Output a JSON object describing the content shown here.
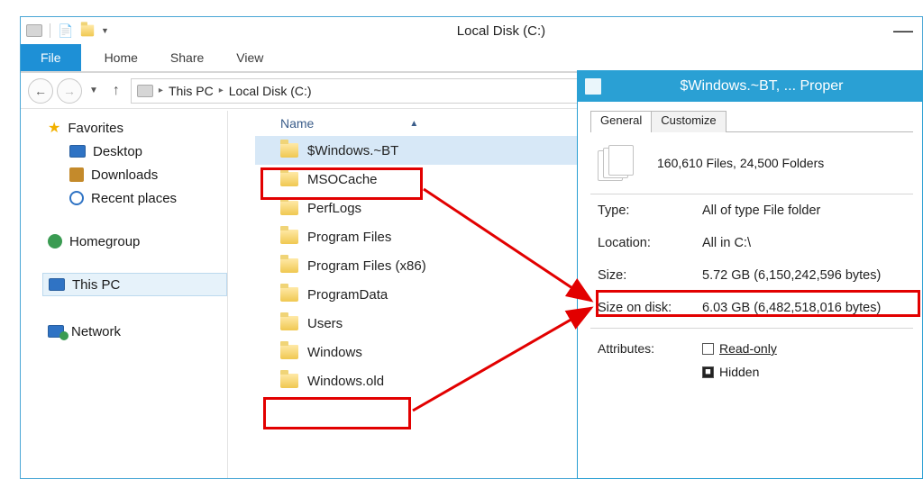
{
  "explorer": {
    "title": "Local Disk (C:)",
    "tabs": {
      "file": "File",
      "home": "Home",
      "share": "Share",
      "view": "View"
    },
    "breadcrumb": {
      "item1": "This PC",
      "item2": "Local Disk (C:)"
    },
    "columns": {
      "name": "Name"
    },
    "nav": {
      "favorites": "Favorites",
      "desktop": "Desktop",
      "downloads": "Downloads",
      "recent": "Recent places",
      "homegroup": "Homegroup",
      "thispc": "This PC",
      "network": "Network"
    },
    "files": [
      "$Windows.~BT",
      "MSOCache",
      "PerfLogs",
      "Program Files",
      "Program Files (x86)",
      "ProgramData",
      "Users",
      "Windows",
      "Windows.old"
    ]
  },
  "props": {
    "title": "$Windows.~BT, ... Proper",
    "tabs": {
      "general": "General",
      "customize": "Customize"
    },
    "filecount": "160,610 Files, 24,500 Folders",
    "type_label": "Type:",
    "type_value": "All of type File folder",
    "location_label": "Location:",
    "location_value": "All in C:\\",
    "size_label": "Size:",
    "size_value": "5.72 GB (6,150,242,596 bytes)",
    "sizeondisk_label": "Size on disk:",
    "sizeondisk_value": "6.03 GB (6,482,518,016 bytes)",
    "attributes_label": "Attributes:",
    "readonly": "Read-only",
    "hidden": "Hidden"
  }
}
